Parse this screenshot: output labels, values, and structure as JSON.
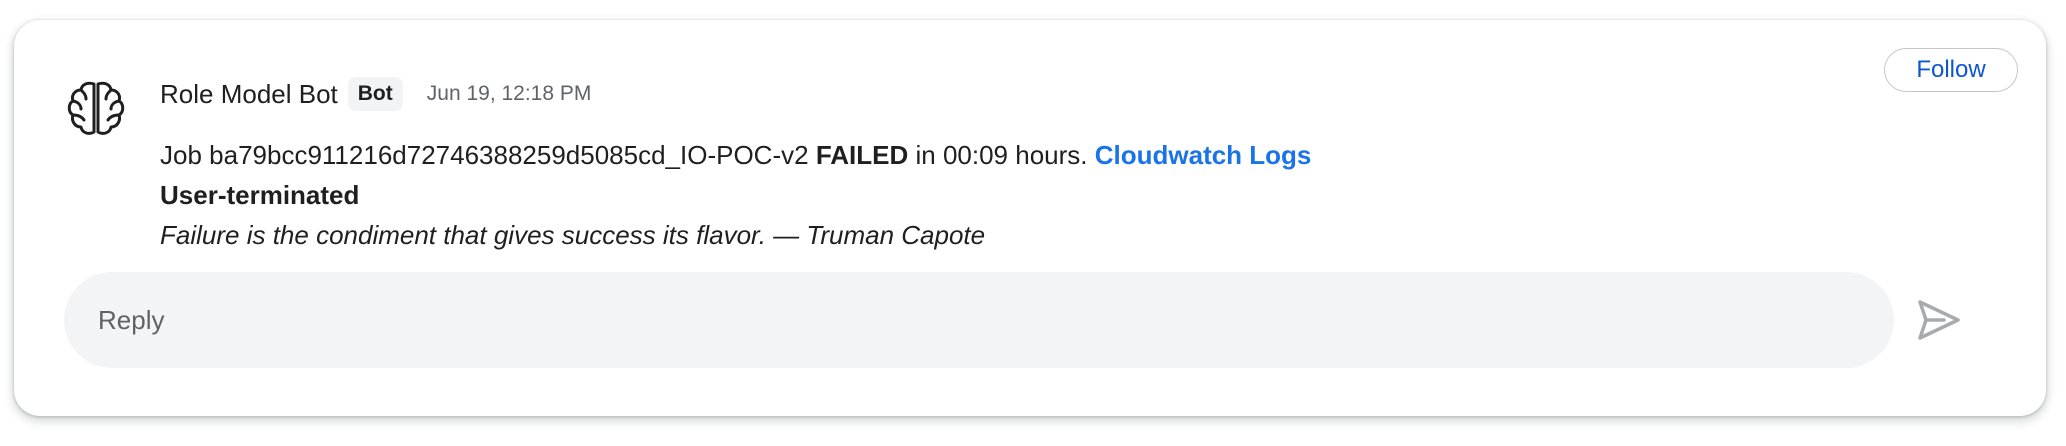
{
  "message": {
    "sender": "Role Model Bot",
    "badge": "Bot",
    "timestamp": "Jun 19, 12:18 PM",
    "line1": {
      "prefix": "Job ba79bcc911216d72746388259d5085cd_IO-POC-v2 ",
      "status": "FAILED",
      "middle": " in 00:09 hours. ",
      "link_label": "Cloudwatch Logs"
    },
    "line2": "User-terminated",
    "line3": "Failure is the condiment that gives success its flavor. — Truman Capote"
  },
  "follow_label": "Follow",
  "reply": {
    "placeholder": "Reply"
  },
  "icons": {
    "avatar": "brain-icon",
    "send": "send-icon"
  },
  "colors": {
    "link": "#1a73e8",
    "follow_text": "#0b57d0",
    "reply_bg": "#f3f4f6",
    "send_icon": "#a7abb0"
  }
}
